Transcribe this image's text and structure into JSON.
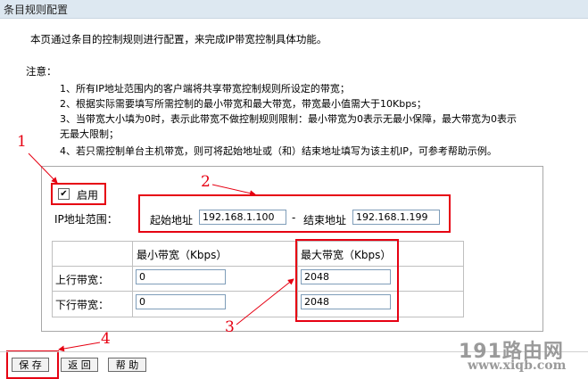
{
  "page": {
    "title": "条目规则配置",
    "description": "本页通过条目的控制规则进行配置，来完成IP带宽控制具体功能。",
    "notes_heading": "注意：",
    "notes": [
      "1、所有IP地址范围内的客户端将共享带宽控制规则所设定的带宽；",
      "2、根据实际需要填写所需控制的最小带宽和最大带宽，带宽最小值需大于10Kbps；",
      "3、当带宽大小填为0时，表示此带宽不做控制规则限制：最小带宽为0表示无最小保障，最大带宽为0表示",
      "无最大限制；",
      "4、若只需控制单台主机带宽，则可将起始地址或（和）结束地址填写为该主机IP，可参考帮助示例。"
    ]
  },
  "form": {
    "enable_label": "启用",
    "enable_checked": true,
    "ip_range_label": "IP地址范围：",
    "start_label": "起始地址",
    "start_value": "192.168.1.100",
    "dash": "-",
    "end_label": "结束地址",
    "end_value": "192.168.1.199",
    "min_header": "最小带宽（Kbps）",
    "max_header": "最大带宽（Kbps）",
    "up_label": "上行带宽：",
    "down_label": "下行带宽：",
    "up_min": "0",
    "up_max": "2048",
    "down_min": "0",
    "down_max": "2048"
  },
  "buttons": {
    "save": "保 存",
    "back": "返 回",
    "help": "帮 助"
  },
  "annotations": {
    "a1": "1",
    "a2": "2",
    "a3": "3",
    "a4": "4"
  },
  "watermark": {
    "line1": "191路由网",
    "line2": "www.xiqb.com"
  },
  "colors": {
    "annotation": "#e60012",
    "title_bg": "#dde8f1"
  }
}
